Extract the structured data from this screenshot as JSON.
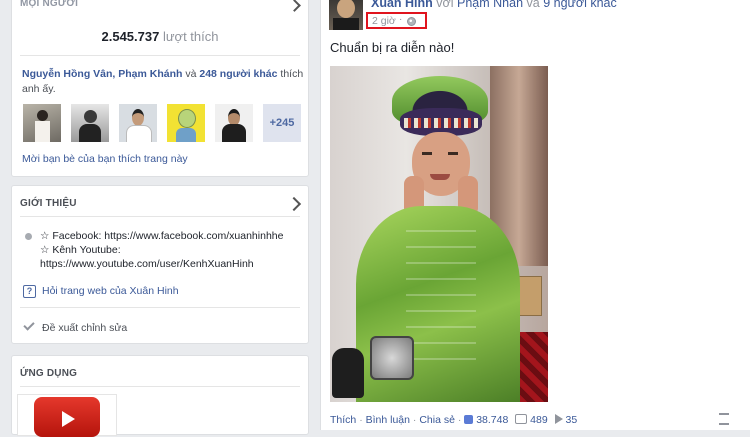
{
  "likes_card": {
    "header": "MỌI NGƯỜI",
    "likes_count": "2.545.737",
    "likes_label": "lượt thích",
    "friend_names": "Nguyễn Hồng Vân, Phạm Khánh",
    "friend_connector": "và",
    "friend_others": "248 người khác",
    "friend_suffix": "thích anh ấy.",
    "more_count": "+245",
    "invite_text": "Mời bạn bè của bạn thích trang này"
  },
  "about_card": {
    "header": "GIỚI THIỆU",
    "facebook_line": "☆ Facebook: https://www.facebook.com/xuanhinhhe",
    "youtube_line": "☆ Kênh Youtube:",
    "youtube_url": "https://www.youtube.com/user/KenhXuanHinh",
    "ask_link": "Hỏi trang web của Xuân Hinh",
    "suggest_edit": "Đề xuất chỉnh sửa"
  },
  "apps_card": {
    "header": "ỨNG DỤNG"
  },
  "post": {
    "author": "Xuân Hinh",
    "with_word": "với",
    "tagged": "Phạm Nhân",
    "and_word": "và",
    "others": "9 người khác",
    "time": "2 giờ",
    "caption": "Chuẩn bị ra diễn nào!",
    "like_action": "Thích",
    "comment_action": "Bình luận",
    "share_action": "Chia sẻ",
    "like_count": "38.748",
    "comment_count": "489",
    "share_count": "35"
  },
  "colors": {
    "link": "#3b5998",
    "highlight": "#e0141e"
  }
}
